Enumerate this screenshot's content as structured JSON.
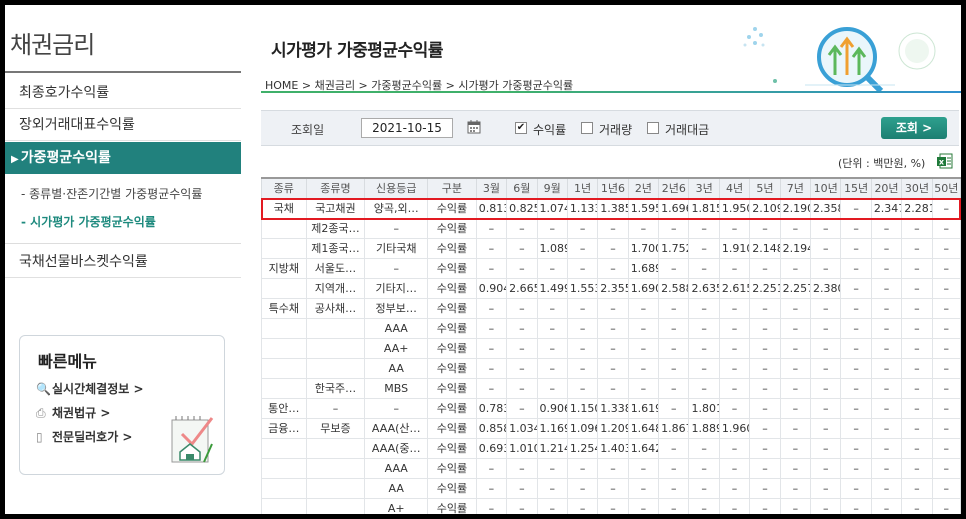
{
  "sidebar": {
    "title": "채권금리",
    "items": [
      {
        "label": "최종호가수익률"
      },
      {
        "label": "장외거래대표수익률"
      },
      {
        "label": "가중평균수익률",
        "arrow": "▶"
      }
    ],
    "sub_items": [
      {
        "label": "- 종류별·잔존기간별 가중평균수익률"
      },
      {
        "label": "- 시가평가 가중평균수익률"
      }
    ],
    "after_item": {
      "label": "국채선물바스켓수익률"
    },
    "quick": {
      "title": "빠른메뉴",
      "links": [
        {
          "label": "실시간체결정보 >",
          "icon": "magnifier-icon",
          "glyph": "🔍"
        },
        {
          "label": "채권법규 >",
          "icon": "printer-icon",
          "glyph": "⎙"
        },
        {
          "label": "전문딜러호가 >",
          "icon": "document-icon",
          "glyph": "▯"
        }
      ]
    }
  },
  "main": {
    "title": "시가평가 가중평균수익률",
    "breadcrumb": "HOME > 채권금리 > 가중평균수익률 > 시가평가 가중평균수익률",
    "search": {
      "date_label": "조회일",
      "date_value": "2021-10-15",
      "checks": [
        {
          "label": "수익률",
          "checked": true,
          "mark": "✔"
        },
        {
          "label": "거래량",
          "checked": false,
          "mark": ""
        },
        {
          "label": "거래대금",
          "checked": false,
          "mark": ""
        }
      ],
      "button": "조회 >"
    },
    "unit": "(단위 : 백만원, %)"
  },
  "table": {
    "headers": [
      "종류",
      "종류명",
      "신용등급",
      "구분",
      "3월",
      "6월",
      "9월",
      "1년",
      "1년6",
      "2년",
      "2년6",
      "3년",
      "4년",
      "5년",
      "7년",
      "10년",
      "15년",
      "20년",
      "30년",
      "50년"
    ],
    "rows": [
      [
        "국채",
        "국고채권",
        "양곡,외…",
        "수익률",
        "0.813",
        "0.825",
        "1.074",
        "1.133",
        "1.385",
        "1.595",
        "1.696",
        "1.815",
        "1.950",
        "2.109",
        "2.190",
        "2.358",
        "–",
        "2.347",
        "2.281",
        "–"
      ],
      [
        "",
        "제2종국…",
        "–",
        "수익률",
        "–",
        "–",
        "–",
        "–",
        "–",
        "–",
        "–",
        "–",
        "–",
        "–",
        "–",
        "–",
        "–",
        "–",
        "–",
        "–"
      ],
      [
        "",
        "제1종국…",
        "기타국채",
        "수익률",
        "–",
        "–",
        "1.089",
        "–",
        "–",
        "1.700",
        "1.752",
        "–",
        "1.910",
        "2.148",
        "2.194",
        "–",
        "–",
        "–",
        "–",
        "–"
      ],
      [
        "지방채",
        "서울도…",
        "–",
        "수익률",
        "–",
        "–",
        "–",
        "–",
        "–",
        "1.689",
        "–",
        "–",
        "–",
        "–",
        "–",
        "–",
        "–",
        "–",
        "–",
        "–"
      ],
      [
        "",
        "지역개…",
        "기타지…",
        "수익률",
        "0.904",
        "2.665",
        "1.499",
        "1.553",
        "2.355",
        "1.690",
        "2.588",
        "2.635",
        "2.615",
        "2.251",
        "2.257",
        "2.380",
        "–",
        "–",
        "–",
        "–"
      ],
      [
        "특수채",
        "공사채…",
        "정부보…",
        "수익률",
        "–",
        "–",
        "–",
        "–",
        "–",
        "–",
        "–",
        "–",
        "–",
        "–",
        "–",
        "–",
        "–",
        "–",
        "–",
        "–"
      ],
      [
        "",
        "",
        "AAA",
        "수익률",
        "–",
        "–",
        "–",
        "–",
        "–",
        "–",
        "–",
        "–",
        "–",
        "–",
        "–",
        "–",
        "–",
        "–",
        "–",
        "–"
      ],
      [
        "",
        "",
        "AA+",
        "수익률",
        "–",
        "–",
        "–",
        "–",
        "–",
        "–",
        "–",
        "–",
        "–",
        "–",
        "–",
        "–",
        "–",
        "–",
        "–",
        "–"
      ],
      [
        "",
        "",
        "AA",
        "수익률",
        "–",
        "–",
        "–",
        "–",
        "–",
        "–",
        "–",
        "–",
        "–",
        "–",
        "–",
        "–",
        "–",
        "–",
        "–",
        "–"
      ],
      [
        "",
        "한국주…",
        "MBS",
        "수익률",
        "–",
        "–",
        "–",
        "–",
        "–",
        "–",
        "–",
        "–",
        "–",
        "–",
        "–",
        "–",
        "–",
        "–",
        "–",
        "–"
      ],
      [
        "통안…",
        "–",
        "–",
        "수익률",
        "0.783",
        "–",
        "0.906",
        "1.150",
        "1.338",
        "1.619",
        "–",
        "1.801",
        "–",
        "–",
        "–",
        "–",
        "–",
        "–",
        "–",
        "–"
      ],
      [
        "금융…",
        "무보증",
        "AAA(산…",
        "수익률",
        "0.858",
        "1.034",
        "1.169",
        "1.096",
        "1.209",
        "1.648",
        "1.867",
        "1.889",
        "1.960",
        "–",
        "–",
        "–",
        "–",
        "–",
        "–",
        "–"
      ],
      [
        "",
        "",
        "AAA(중…",
        "수익률",
        "0.693",
        "1.010",
        "1.214",
        "1.254",
        "1.403",
        "1.642",
        "–",
        "–",
        "–",
        "–",
        "–",
        "–",
        "–",
        "–",
        "–",
        "–"
      ],
      [
        "",
        "",
        "AAA",
        "수익률",
        "–",
        "–",
        "–",
        "–",
        "–",
        "–",
        "–",
        "–",
        "–",
        "–",
        "–",
        "–",
        "–",
        "–",
        "–",
        "–"
      ],
      [
        "",
        "",
        "AA",
        "수익률",
        "–",
        "–",
        "–",
        "–",
        "–",
        "–",
        "–",
        "–",
        "–",
        "–",
        "–",
        "–",
        "–",
        "–",
        "–",
        "–"
      ],
      [
        "",
        "",
        "A+",
        "수익률",
        "–",
        "–",
        "–",
        "–",
        "–",
        "–",
        "–",
        "–",
        "–",
        "–",
        "–",
        "–",
        "–",
        "–",
        "–",
        "–"
      ]
    ]
  },
  "colors": {
    "accent": "#21817d",
    "highlight": "#e21a22"
  }
}
